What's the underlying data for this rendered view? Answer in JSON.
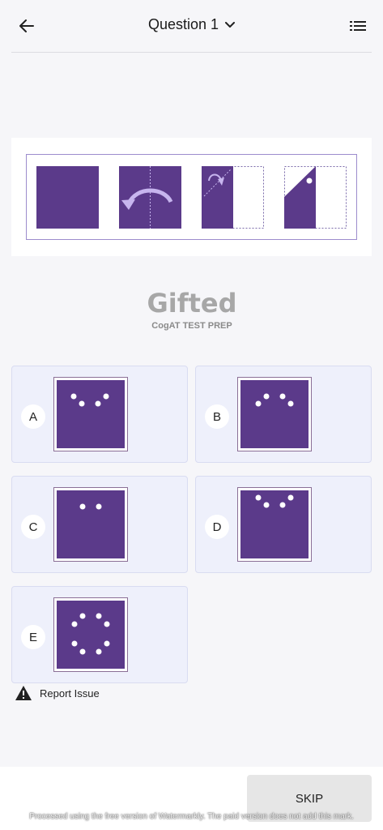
{
  "header": {
    "title": "Question 1",
    "back_icon": "arrow-left-icon",
    "dropdown_icon": "chevron-down-icon",
    "menu_icon": "list-icon"
  },
  "question": {
    "steps": [
      "unfolded-square",
      "fold-arrow",
      "folded-half-with-arrow",
      "folded-triangle-with-hole"
    ],
    "colors": {
      "paper": "#5b3a8a",
      "accent": "#c7b5ee"
    }
  },
  "logo": {
    "title": "Gifted",
    "subtitle": "CogAT TEST PREP"
  },
  "options": [
    {
      "letter": "A",
      "pattern": "four-holes-v"
    },
    {
      "letter": "B",
      "pattern": "four-holes-inverted-v"
    },
    {
      "letter": "C",
      "pattern": "two-holes"
    },
    {
      "letter": "D",
      "pattern": "four-holes-top"
    },
    {
      "letter": "E",
      "pattern": "eight-holes-ring"
    }
  ],
  "report": {
    "label": "Report Issue",
    "icon": "warning-icon"
  },
  "footer": {
    "skip_label": "SKIP",
    "watermark": "Processed using the free version of Watermarkly. The paid version does not add this mark."
  }
}
